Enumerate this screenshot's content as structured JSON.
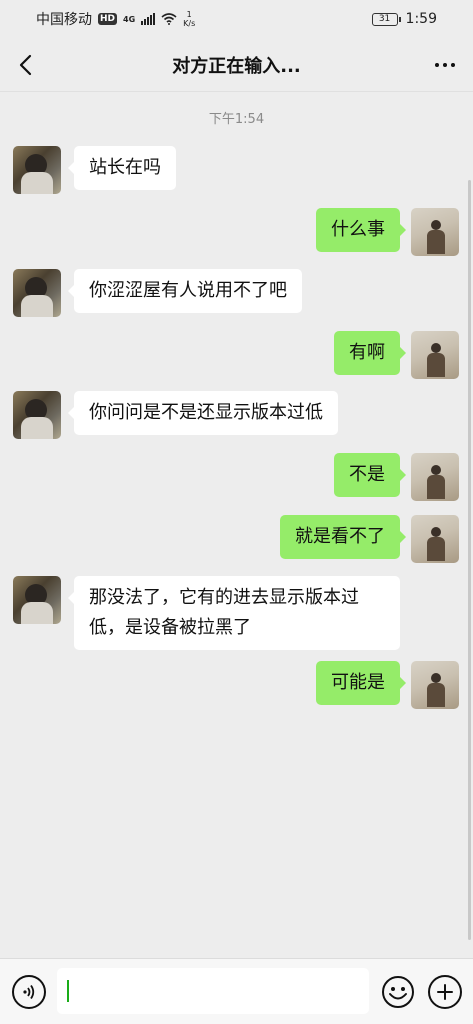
{
  "status": {
    "carrier": "中国移动",
    "hd": "HD",
    "network": "4G",
    "speed_value": "1",
    "speed_unit": "K/s",
    "battery": "31",
    "time": "1:59"
  },
  "header": {
    "title": "对方正在输入..."
  },
  "chat": {
    "timestamp": "下午1:54",
    "messages": [
      {
        "side": "left",
        "text": "站长在吗"
      },
      {
        "side": "right",
        "text": "什么事"
      },
      {
        "side": "left",
        "text": "你涩涩屋有人说用不了吧"
      },
      {
        "side": "right",
        "text": "有啊"
      },
      {
        "side": "left",
        "text": "你问问是不是还显示版本过低"
      },
      {
        "side": "right",
        "text": "不是"
      },
      {
        "side": "right",
        "text": "就是看不了"
      },
      {
        "side": "left",
        "text_line1": "那没法了，它有的进去显示版本过",
        "text_line2": "低，是设备被拉黑了"
      },
      {
        "side": "right",
        "text": "可能是"
      }
    ]
  },
  "input": {
    "value": ""
  },
  "colors": {
    "background": "#ededed",
    "own_bubble": "#95ec69",
    "other_bubble": "#ffffff",
    "caret": "#1aad19"
  }
}
